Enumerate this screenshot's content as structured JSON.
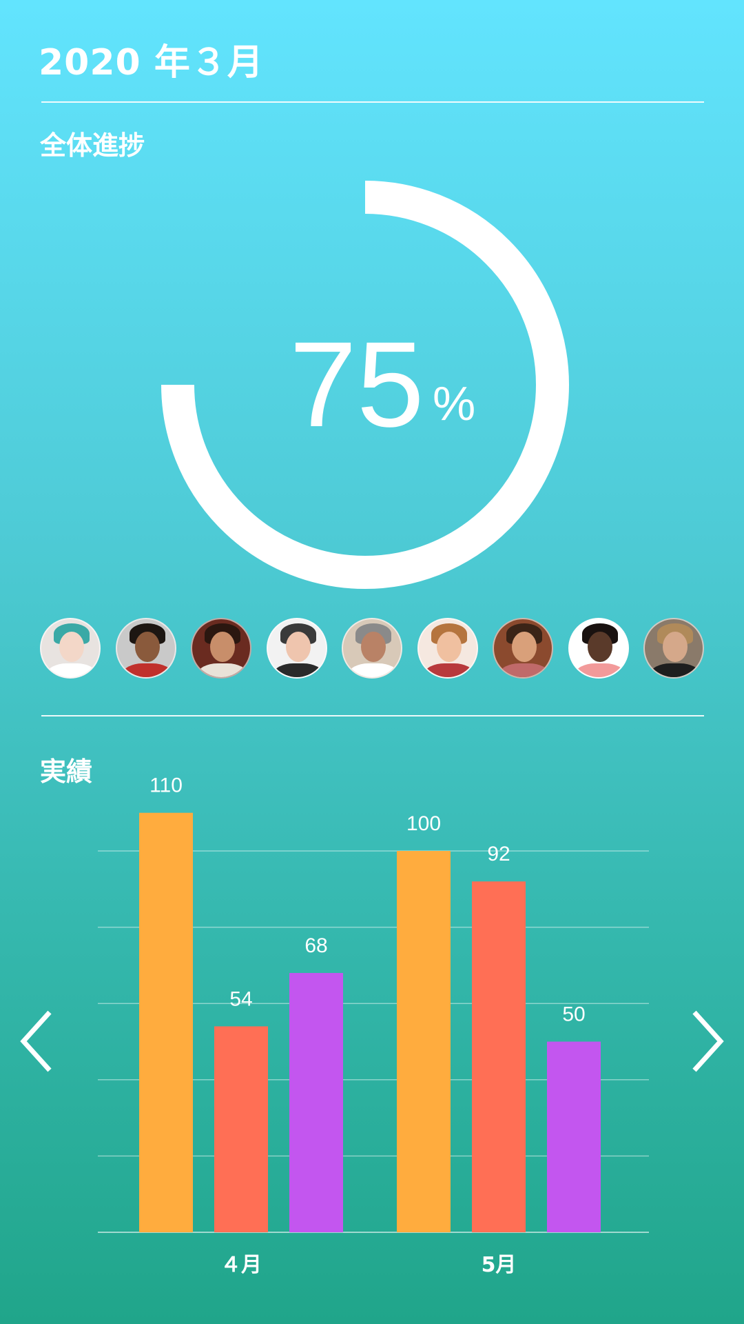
{
  "header": {
    "title": "2020 年３月"
  },
  "progress": {
    "label": "全体進捗",
    "value": "75",
    "unit": "%",
    "fraction": 0.75
  },
  "members": [
    {
      "name": "member-1",
      "skin": "#f3d7c8",
      "hair": "#3aa9a6",
      "bg": "#e8e3e0",
      "shirt": "#ffffff"
    },
    {
      "name": "member-2",
      "skin": "#8a5a3c",
      "hair": "#1d1612",
      "bg": "#c9c9c9",
      "shirt": "#c0302c"
    },
    {
      "name": "member-3",
      "skin": "#c88e6a",
      "hair": "#2b1710",
      "bg": "#6a2b20",
      "shirt": "#e9e2d8"
    },
    {
      "name": "member-4",
      "skin": "#efc5ae",
      "hair": "#3a3a3a",
      "bg": "#f2f2f2",
      "shirt": "#2a2a2a"
    },
    {
      "name": "member-5",
      "skin": "#b98266",
      "hair": "#8a8a8a",
      "bg": "#d8c9b8",
      "shirt": "#ffffff"
    },
    {
      "name": "member-6",
      "skin": "#f0c0a0",
      "hair": "#b5743e",
      "bg": "#f5e8e0",
      "shirt": "#b8393c"
    },
    {
      "name": "member-7",
      "skin": "#d9a07a",
      "hair": "#3b2417",
      "bg": "#8b4a2e",
      "shirt": "#c06a6a"
    },
    {
      "name": "member-8",
      "skin": "#5a3a2a",
      "hair": "#1a1210",
      "bg": "#ffffff",
      "shirt": "#f29a9a"
    },
    {
      "name": "member-9",
      "skin": "#d5a88a",
      "hair": "#b08a5a",
      "bg": "#8a7a6a",
      "shirt": "#1e1e1e"
    }
  ],
  "results": {
    "label": "実績"
  },
  "chart_data": {
    "type": "bar",
    "categories": [
      "４月",
      "5月"
    ],
    "series": [
      {
        "color": "#ffac3e",
        "values": [
          110,
          100
        ]
      },
      {
        "color": "#ff6f55",
        "values": [
          54,
          92
        ]
      },
      {
        "color": "#c356ef",
        "values": [
          68,
          50
        ]
      }
    ],
    "ylim": [
      0,
      100
    ],
    "grid": true
  },
  "nav": {
    "prev_icon": "chevron-left-icon",
    "next_icon": "chevron-right-icon"
  }
}
